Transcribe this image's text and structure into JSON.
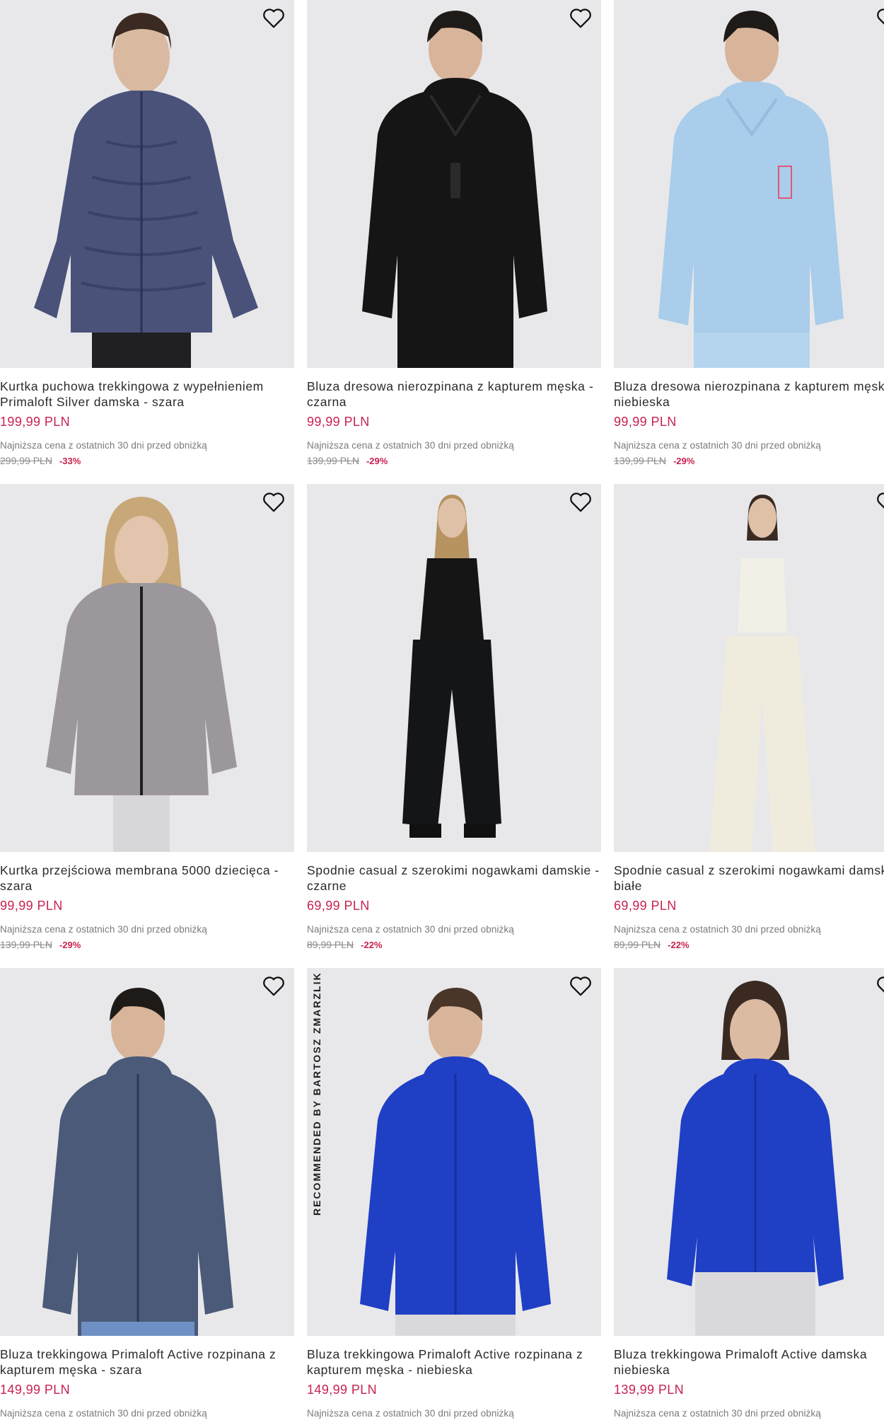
{
  "favorite_icon": "heart-outline-icon",
  "colors": {
    "price": "#c8224e",
    "image_bg": "#e6e6e8"
  },
  "products": [
    {
      "title": "Kurtka puchowa trekkingowa z wypełnieniem Primaloft Silver damska - szara",
      "price": "199,99 PLN",
      "lowest_label": "Najniższa cena z ostatnich 30 dni przed obniżką",
      "old_price": "299,99 PLN",
      "discount": "-33%",
      "image": "woman-navy-quilted-jacket"
    },
    {
      "title": "Bluza dresowa nierozpinana z kapturem męska - czarna",
      "price": "99,99 PLN",
      "lowest_label": "Najniższa cena z ostatnich 30 dni przed obniżką",
      "old_price": "139,99 PLN",
      "discount": "-29%",
      "image": "man-black-hoodie"
    },
    {
      "title": "Bluza dresowa nierozpinana z kapturem męska - niebieska",
      "price": "99,99 PLN",
      "lowest_label": "Najniższa cena z ostatnich 30 dni przed obniżką",
      "old_price": "139,99 PLN",
      "discount": "-29%",
      "image": "man-light-blue-hoodie"
    },
    {
      "title": "Kurtka przejściowa membrana 5000 dziecięca - szara",
      "price": "99,99 PLN",
      "lowest_label": "Najniższa cena z ostatnich 30 dni przed obniżką",
      "old_price": "139,99 PLN",
      "discount": "-29%",
      "image": "girl-grey-jacket"
    },
    {
      "title": "Spodnie casual z szerokimi nogawkami damskie - czarne",
      "price": "69,99 PLN",
      "lowest_label": "Najniższa cena z ostatnich 30 dni przed obniżką",
      "old_price": "89,99 PLN",
      "discount": "-22%",
      "image": "woman-black-wide-pants"
    },
    {
      "title": "Spodnie casual z szerokimi nogawkami damskie - białe",
      "price": "69,99 PLN",
      "lowest_label": "Najniższa cena z ostatnich 30 dni przed obniżką",
      "old_price": "89,99 PLN",
      "discount": "-22%",
      "image": "woman-white-wide-pants"
    },
    {
      "title": "Bluza trekkingowa Primaloft Active rozpinana z kapturem męska - szara",
      "price": "149,99 PLN",
      "lowest_label": "Najniższa cena z ostatnich 30 dni przed obniżką",
      "old_price": "",
      "discount": "",
      "image": "man-navy-fleece"
    },
    {
      "title": "Bluza trekkingowa Primaloft Active rozpinana z kapturem męska - niebieska",
      "price": "149,99 PLN",
      "lowest_label": "Najniższa cena z ostatnich 30 dni przed obniżką",
      "old_price": "",
      "discount": "",
      "image": "man-blue-fleece",
      "badge": "RECOMMENDED BY BARTOSZ ZMARZLIK"
    },
    {
      "title": "Bluza trekkingowa Primaloft Active damska niebieska",
      "price": "139,99 PLN",
      "lowest_label": "Najniższa cena z ostatnich 30 dni przed obniżką",
      "old_price": "",
      "discount": "",
      "image": "woman-blue-fleece"
    }
  ]
}
